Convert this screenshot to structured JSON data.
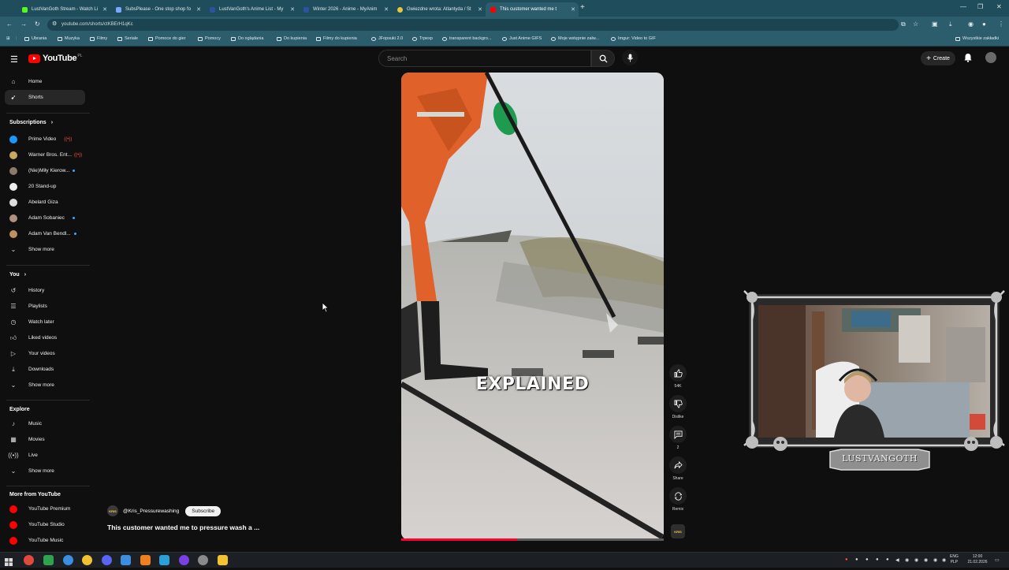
{
  "browser": {
    "tabs": [
      {
        "title": "LustVanGoth Stream - Watch Li",
        "color": "#53fc18"
      },
      {
        "title": "SubsPlease - One stop shop fo",
        "color": "#7aa7ff"
      },
      {
        "title": "LustVanGoth's Anime List - My",
        "color": "#2e51a2"
      },
      {
        "title": "Winter 2026 - Anime - MyAnim",
        "color": "#2e51a2"
      },
      {
        "title": "Gwiezdne wrota: Atlantyda / St",
        "color": "#e7c63a"
      },
      {
        "title": "This customer wanted me t",
        "color": "#ff0000"
      }
    ],
    "new_tab": "+",
    "url": "youtube.com/shorts/ctKBErH1qKc",
    "bookmarks": [
      "Ubrania",
      "Muzyka",
      "Filmy",
      "Seriale",
      "Pomoce do gier",
      "Pomocy",
      "Do oglądania",
      "Do kupienia",
      "Filmy do kupienia",
      "JFopsuki 2.0",
      "Trpexp",
      "transparent backgro...",
      "Just Anime GIFS",
      "Moje wstępnie załw...",
      "Imgur: Video to GIF"
    ],
    "all_bookmarks": "Wszystkie zakładki"
  },
  "youtube": {
    "logo": "YouTube",
    "country": "PL",
    "search_placeholder": "Search",
    "create_label": "Create",
    "nav": [
      {
        "label": "Home",
        "icon": "home-icon"
      },
      {
        "label": "Shorts",
        "icon": "shorts-icon",
        "selected": true
      }
    ],
    "subscriptions_header": "Subscriptions",
    "subscriptions": [
      {
        "label": "Prime Video",
        "color": "#1a98ff",
        "live": true
      },
      {
        "label": "Warner Bros. Ent...",
        "color": "#c8a860",
        "live": true
      },
      {
        "label": "(Nie)Miły Kierow...",
        "color": "#8a7b6a",
        "dot": true
      },
      {
        "label": "20 Stand-up",
        "color": "#eeeeee"
      },
      {
        "label": "Abelard Giza",
        "color": "#dddddd"
      },
      {
        "label": "Adam Sobaniec",
        "color": "#b09080",
        "dot": true
      },
      {
        "label": "Adam Van Bendl...",
        "color": "#c09060",
        "dot": true
      }
    ],
    "show_more": "Show more",
    "you_header": "You",
    "you_items": [
      {
        "label": "History",
        "icon": "history-icon"
      },
      {
        "label": "Playlists",
        "icon": "playlists-icon"
      },
      {
        "label": "Watch later",
        "icon": "watch-later-icon"
      },
      {
        "label": "Liked videos",
        "icon": "liked-videos-icon"
      },
      {
        "label": "Your videos",
        "icon": "your-videos-icon"
      },
      {
        "label": "Downloads",
        "icon": "downloads-icon"
      }
    ],
    "explore_header": "Explore",
    "explore_items": [
      {
        "label": "Music",
        "icon": "music-icon"
      },
      {
        "label": "Movies",
        "icon": "movies-icon"
      },
      {
        "label": "Live",
        "icon": "live-icon"
      }
    ],
    "more_header": "More from YouTube",
    "more_items": [
      {
        "label": "YouTube Premium",
        "color": "#ff0000"
      },
      {
        "label": "YouTube Studio",
        "color": "#ff0000"
      },
      {
        "label": "YouTube Music",
        "color": "#ff0000"
      }
    ],
    "short": {
      "caption": "EXPLAINED",
      "channel": "@Kris_Pressurewashing",
      "subscribe": "Subscribe",
      "title": "This customer wanted me to pressure wash a ...",
      "likes": "54K",
      "dislike": "Dislike",
      "comments": "2",
      "share": "Share",
      "remix": "Remix",
      "channel_badge": "KRIS",
      "progress": 0.44
    },
    "webcam_name": "LUSTVANGOTH"
  },
  "taskbar": {
    "lang": "ENG",
    "lang2": "PLP",
    "time": "12:00",
    "date": "21.02.2026"
  }
}
